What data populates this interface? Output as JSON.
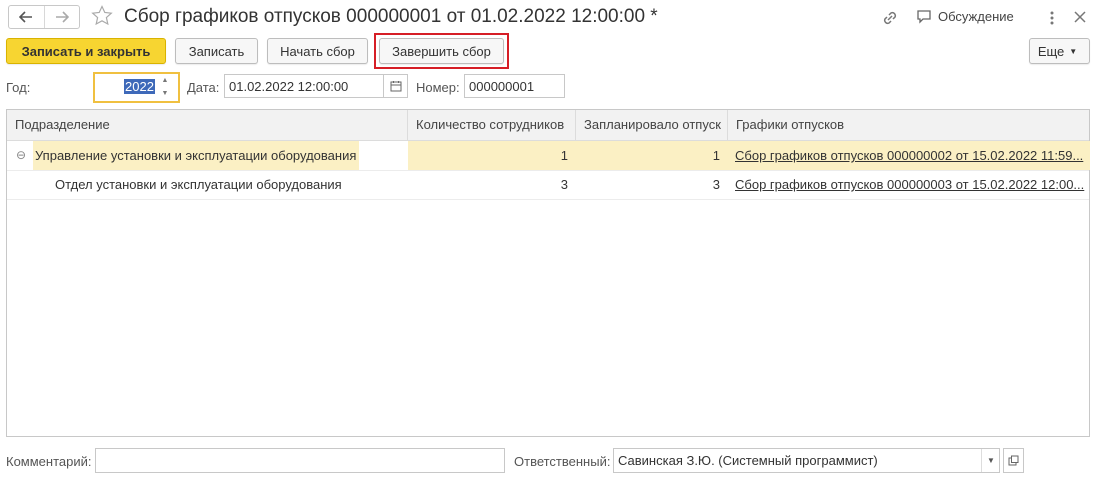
{
  "window": {
    "title": "Сбор графиков отпусков 000000001 от 01.02.2022 12:00:00 *",
    "discussion_label": "Обсуждение",
    "back_icon": "arrow-left-icon",
    "forward_icon": "arrow-right-icon"
  },
  "toolbar": {
    "save_close_label": "Записать и закрыть",
    "save_label": "Записать",
    "start_label": "Начать сбор",
    "finish_label": "Завершить сбор",
    "more_label": "Еще",
    "highlight_color": "#d61e26"
  },
  "fields": {
    "year_label": "Год:",
    "year_value": "2022",
    "date_label": "Дата:",
    "date_value": "01.02.2022 12:00:00",
    "number_label": "Номер:",
    "number_value": "000000001"
  },
  "table": {
    "columns": [
      "Подразделение",
      "Количество сотрудников",
      "Запланировало отпуск",
      "Графики отпусков"
    ],
    "rows": [
      {
        "department": "Управление установки и эксплуатации оборудования",
        "employees": "1",
        "planned": "1",
        "schedule": "Сбор графиков отпусков 000000002 от 15.02.2022 11:59...",
        "selected": true,
        "collapse_symbol": "⊖"
      },
      {
        "department": "Отдел установки и эксплуатации оборудования",
        "employees": "3",
        "planned": "3",
        "schedule": "Сбор графиков отпусков 000000003 от 15.02.2022 12:00...",
        "selected": false
      }
    ]
  },
  "footer": {
    "comment_label": "Комментарий:",
    "comment_value": "",
    "responsible_label": "Ответственный:",
    "responsible_value": "Савинская З.Ю. (Системный программист)"
  },
  "colors": {
    "accent_yellow": "#f7d531",
    "selection_bg": "#fbf0c4",
    "focus_border": "#f0c040"
  }
}
